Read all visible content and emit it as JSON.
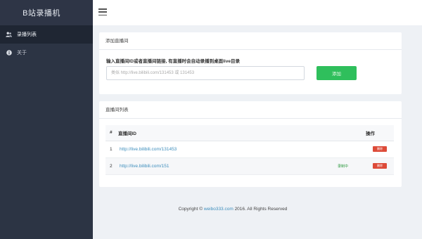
{
  "sidebar": {
    "brand": "B站录播机",
    "items": [
      {
        "label": "录播列表",
        "icon": "users-icon"
      },
      {
        "label": "关于",
        "icon": "info-icon"
      }
    ]
  },
  "add_card": {
    "title": "添加直播间",
    "field_label": "输入直播间ID或者直播间链接, 有直播时会自动录播到桌面live目录",
    "input_placeholder": "类似 http://live.bilibili.com/131453 或 131453",
    "add_button": "添加"
  },
  "list_card": {
    "title": "直播间列表",
    "columns": {
      "num": "#",
      "room": "直播间ID",
      "action": "操作"
    },
    "rows": [
      {
        "num": "1",
        "link": "http://live.bilibili.com/131453",
        "status": "",
        "action": "删除"
      },
      {
        "num": "2",
        "link": "http://live.bilibili.com/151",
        "status": "录制中",
        "action": "删除"
      }
    ]
  },
  "footer": {
    "prefix": "Copyright © ",
    "link": "weibo333.com",
    "suffix": " 2016. All Rights Reserved"
  },
  "colors": {
    "sidebar_bg": "#2c3444",
    "accent_green": "#2fbf5c",
    "danger_red": "#dd4b39",
    "link_blue": "#3c8dbc"
  }
}
